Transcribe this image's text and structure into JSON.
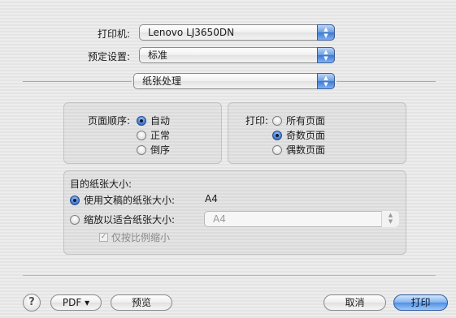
{
  "printer": {
    "label": "打印机:",
    "value": "Lenovo LJ3650DN"
  },
  "presets": {
    "label": "预定设置:",
    "value": "标准"
  },
  "section": {
    "value": "纸张处理"
  },
  "page_order": {
    "label": "页面顺序:",
    "options": [
      "自动",
      "正常",
      "倒序"
    ],
    "selected": "自动"
  },
  "print_pages": {
    "label": "打印:",
    "options": [
      "所有页面",
      "奇数页面",
      "偶数页面"
    ],
    "selected": "奇数页面"
  },
  "paper_size": {
    "label": "目的纸张大小:",
    "use_document": {
      "label": "使用文稿的纸张大小:",
      "value": "A4",
      "selected": true
    },
    "scale_to_fit": {
      "label": "缩放以适合纸张大小:",
      "value": "A4",
      "selected": false
    },
    "scale_down_only": {
      "label": "仅按比例缩小",
      "checked": true,
      "enabled": false
    }
  },
  "footer": {
    "help": "?",
    "pdf": "PDF ▾",
    "preview": "预览",
    "cancel": "取消",
    "print": "打印"
  },
  "colors": {
    "accent": "#3c78d3",
    "background": "#e9e9e9"
  }
}
